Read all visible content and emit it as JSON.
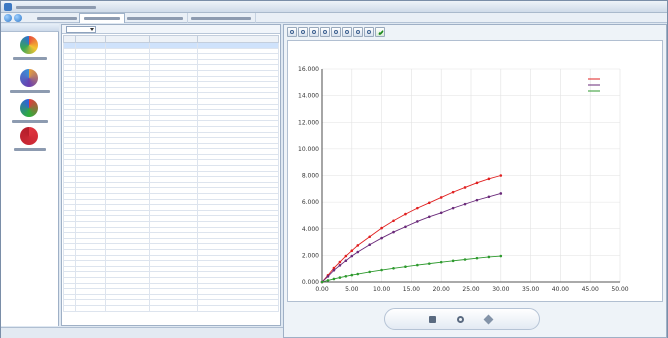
{
  "toolbar": {
    "icons": [
      "open-icon",
      "save-icon",
      "zoom-in-icon",
      "zoom-out-icon",
      "copy-icon",
      "print-icon",
      "settings-icon",
      "light-icon",
      "confirm-icon"
    ]
  },
  "sidebar": {
    "items": [
      {
        "icon": "globe-color-icon",
        "colors": [
          "#e84b3c",
          "#f4c430",
          "#3aa655",
          "#2f6fd0"
        ]
      },
      {
        "icon": "molecule-icon",
        "colors": [
          "#e7a03c",
          "#6a3fb0",
          "#3a8fd6"
        ]
      },
      {
        "icon": "rgb-circles-icon",
        "colors": [
          "#e23b3b",
          "#2fae3a",
          "#2f5fe0"
        ]
      },
      {
        "icon": "red-flower-icon",
        "colors": [
          "#e0343f",
          "#b51d2a"
        ]
      }
    ]
  },
  "chart_data": {
    "type": "line",
    "xlim": [
      0,
      50
    ],
    "ylim": [
      0,
      16000
    ],
    "x_ticks": [
      "0.00",
      "5.00",
      "10.00",
      "15.00",
      "20.00",
      "25.00",
      "30.00",
      "35.00",
      "40.00",
      "45.00",
      "50.00"
    ],
    "y_ticks": [
      "0.000",
      "2.000",
      "4.000",
      "6.000",
      "8.000",
      "10.000",
      "12.000",
      "14.000",
      "16.000"
    ],
    "x": [
      0,
      1,
      2,
      3,
      4,
      5,
      6,
      8,
      10,
      12,
      14,
      16,
      18,
      20,
      22,
      24,
      26,
      28,
      30
    ],
    "series": [
      {
        "color": "#e02020",
        "values": [
          0,
          500,
          1050,
          1500,
          1950,
          2350,
          2750,
          3400,
          4050,
          4600,
          5100,
          5550,
          5950,
          6350,
          6750,
          7100,
          7450,
          7750,
          8000
        ]
      },
      {
        "color": "#6a2a7a",
        "values": [
          0,
          420,
          880,
          1250,
          1600,
          1950,
          2250,
          2800,
          3300,
          3750,
          4150,
          4550,
          4900,
          5200,
          5550,
          5850,
          6150,
          6400,
          6650
        ]
      },
      {
        "color": "#2e9a2e",
        "values": [
          0,
          120,
          230,
          330,
          430,
          520,
          600,
          760,
          900,
          1030,
          1150,
          1270,
          1380,
          1490,
          1590,
          1690,
          1790,
          1880,
          1950
        ]
      }
    ]
  }
}
